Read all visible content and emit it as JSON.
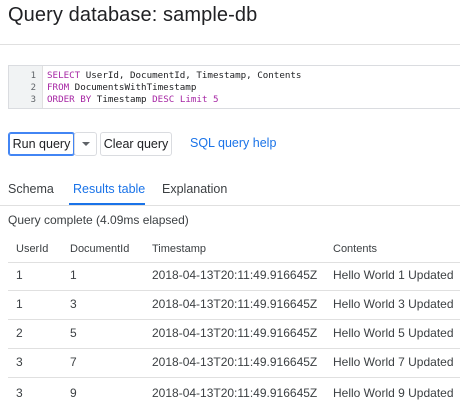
{
  "page": {
    "title": "Query database: sample-db"
  },
  "editor": {
    "lines": [
      {
        "num": "1",
        "parts": [
          {
            "t": "SELECT",
            "k": "kw"
          },
          {
            "t": " UserId, DocumentId, Timestamp, Contents",
            "k": "ident"
          }
        ]
      },
      {
        "num": "2",
        "parts": [
          {
            "t": "FROM",
            "k": "kw"
          },
          {
            "t": " DocumentsWithTimestamp",
            "k": "ident"
          }
        ]
      },
      {
        "num": "3",
        "parts": [
          {
            "t": "ORDER BY",
            "k": "kw"
          },
          {
            "t": " Timestamp ",
            "k": "ident"
          },
          {
            "t": "DESC",
            "k": "kw"
          },
          {
            "t": " ",
            "k": "ident"
          },
          {
            "t": "Limit",
            "k": "kw"
          },
          {
            "t": " ",
            "k": "ident"
          },
          {
            "t": "5",
            "k": "num"
          }
        ]
      }
    ]
  },
  "toolbar": {
    "run_label": "Run query",
    "clear_label": "Clear query",
    "help_label": "SQL query help"
  },
  "tabs": [
    {
      "label": "Schema",
      "active": false
    },
    {
      "label": "Results table",
      "active": true
    },
    {
      "label": "Explanation",
      "active": false
    }
  ],
  "status": "Query complete (4.09ms elapsed)",
  "table": {
    "columns": [
      "UserId",
      "DocumentId",
      "Timestamp",
      "Contents"
    ],
    "rows": [
      [
        "1",
        "1",
        "2018-04-13T20:11:49.916645Z",
        "Hello World 1 Updated"
      ],
      [
        "1",
        "3",
        "2018-04-13T20:11:49.916645Z",
        "Hello World 3 Updated"
      ],
      [
        "2",
        "5",
        "2018-04-13T20:11:49.916645Z",
        "Hello World 5 Updated"
      ],
      [
        "3",
        "7",
        "2018-04-13T20:11:49.916645Z",
        "Hello World 7 Updated"
      ],
      [
        "3",
        "9",
        "2018-04-13T20:11:49.916645Z",
        "Hello World 9 Updated"
      ]
    ]
  },
  "colors": {
    "accent": "#1a73e8",
    "keyword": "#a626a4",
    "text": "#3c4043",
    "divider": "#e0e0e0"
  }
}
